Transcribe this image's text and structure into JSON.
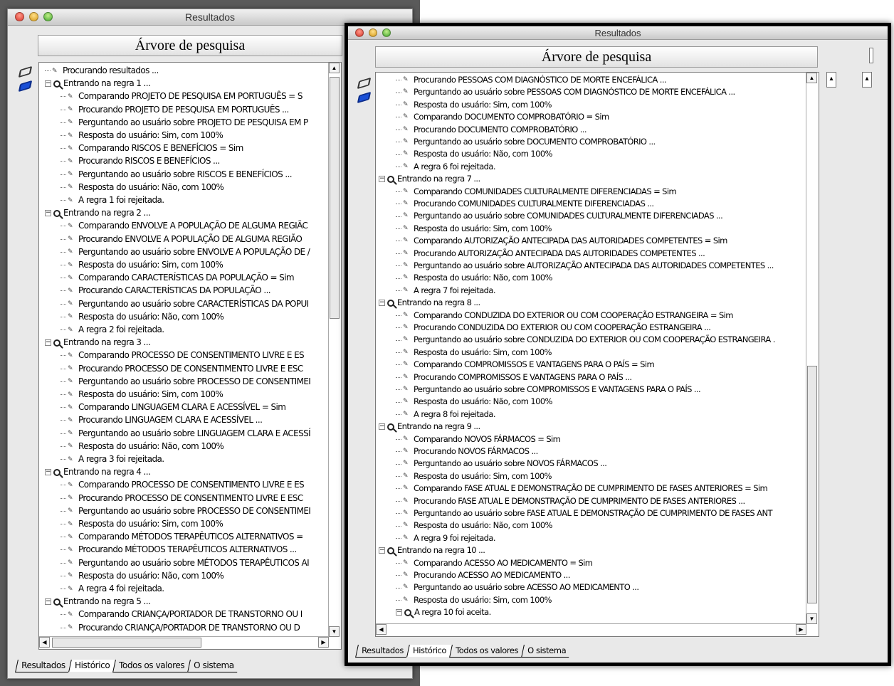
{
  "back_window": {
    "title": "Resultados",
    "header": "Árvore de pesquisa",
    "tabs": [
      "Resultados",
      "Histórico",
      "Todos os valores",
      "O sistema"
    ],
    "active_tab": 1,
    "tree": [
      {
        "level": 0,
        "type": "leaf",
        "text": "Procurando resultados ..."
      },
      {
        "level": 0,
        "type": "rule",
        "text": "Entrando na regra 1 ..."
      },
      {
        "level": 1,
        "type": "leaf",
        "text": "Comparando PROJETO DE PESQUISA EM PORTUGUÊS = S"
      },
      {
        "level": 1,
        "type": "leaf",
        "text": "Procurando PROJETO DE PESQUISA EM PORTUGUÊS ..."
      },
      {
        "level": 1,
        "type": "leaf",
        "text": "Perguntando ao usuário sobre PROJETO DE PESQUISA EM P"
      },
      {
        "level": 1,
        "type": "leaf",
        "text": "Resposta do usuário: Sim, com 100%"
      },
      {
        "level": 1,
        "type": "leaf",
        "text": "Comparando RISCOS E BENEFÍCIOS = Sim"
      },
      {
        "level": 1,
        "type": "leaf",
        "text": "Procurando RISCOS E BENEFÍCIOS ..."
      },
      {
        "level": 1,
        "type": "leaf",
        "text": "Perguntando ao usuário sobre RISCOS E BENEFÍCIOS ..."
      },
      {
        "level": 1,
        "type": "leaf",
        "text": "Resposta do usuário: Não, com 100%"
      },
      {
        "level": 1,
        "type": "leaf",
        "text": "A regra 1 foi rejeitada."
      },
      {
        "level": 0,
        "type": "rule",
        "text": "Entrando na regra 2 ..."
      },
      {
        "level": 1,
        "type": "leaf",
        "text": "Comparando ENVOLVE A POPULAÇÃO DE ALGUMA REGIÃC"
      },
      {
        "level": 1,
        "type": "leaf",
        "text": "Procurando ENVOLVE A POPULAÇÃO DE ALGUMA REGIÃO"
      },
      {
        "level": 1,
        "type": "leaf",
        "text": "Perguntando ao usuário sobre ENVOLVE A POPULAÇÃO DE /"
      },
      {
        "level": 1,
        "type": "leaf",
        "text": "Resposta do usuário: Sim, com 100%"
      },
      {
        "level": 1,
        "type": "leaf",
        "text": "Comparando CARACTERÍSTICAS DA POPULAÇÃO = Sim"
      },
      {
        "level": 1,
        "type": "leaf",
        "text": "Procurando CARACTERÍSTICAS DA POPULAÇÃO ..."
      },
      {
        "level": 1,
        "type": "leaf",
        "text": "Perguntando ao usuário sobre CARACTERÍSTICAS DA POPUI"
      },
      {
        "level": 1,
        "type": "leaf",
        "text": "Resposta do usuário: Não, com 100%"
      },
      {
        "level": 1,
        "type": "leaf",
        "text": "A regra 2 foi rejeitada."
      },
      {
        "level": 0,
        "type": "rule",
        "text": "Entrando na regra 3 ..."
      },
      {
        "level": 1,
        "type": "leaf",
        "text": "Comparando PROCESSO DE CONSENTIMENTO LIVRE E ES"
      },
      {
        "level": 1,
        "type": "leaf",
        "text": "Procurando PROCESSO DE CONSENTIMENTO LIVRE E ESC"
      },
      {
        "level": 1,
        "type": "leaf",
        "text": "Perguntando ao usuário sobre PROCESSO DE CONSENTIMEI"
      },
      {
        "level": 1,
        "type": "leaf",
        "text": "Resposta do usuário: Sim, com 100%"
      },
      {
        "level": 1,
        "type": "leaf",
        "text": "Comparando LINGUAGEM CLARA E ACESSÍVEL = Sim"
      },
      {
        "level": 1,
        "type": "leaf",
        "text": "Procurando LINGUAGEM CLARA E ACESSÍVEL ..."
      },
      {
        "level": 1,
        "type": "leaf",
        "text": "Perguntando ao usuário sobre LINGUAGEM CLARA E ACESSÍ"
      },
      {
        "level": 1,
        "type": "leaf",
        "text": "Resposta do usuário: Não, com 100%"
      },
      {
        "level": 1,
        "type": "leaf",
        "text": "A regra 3 foi rejeitada."
      },
      {
        "level": 0,
        "type": "rule",
        "text": "Entrando na regra 4 ..."
      },
      {
        "level": 1,
        "type": "leaf",
        "text": "Comparando PROCESSO DE CONSENTIMENTO LIVRE E ES"
      },
      {
        "level": 1,
        "type": "leaf",
        "text": "Procurando PROCESSO DE CONSENTIMENTO LIVRE E ESC"
      },
      {
        "level": 1,
        "type": "leaf",
        "text": "Perguntando ao usuário sobre PROCESSO DE CONSENTIMEI"
      },
      {
        "level": 1,
        "type": "leaf",
        "text": "Resposta do usuário: Sim, com 100%"
      },
      {
        "level": 1,
        "type": "leaf",
        "text": "Comparando MÉTODOS TERAPÊUTICOS ALTERNATIVOS ="
      },
      {
        "level": 1,
        "type": "leaf",
        "text": "Procurando MÉTODOS TERAPÊUTICOS ALTERNATIVOS ..."
      },
      {
        "level": 1,
        "type": "leaf",
        "text": "Perguntando ao usuário sobre MÉTODOS TERAPÊUTICOS AI"
      },
      {
        "level": 1,
        "type": "leaf",
        "text": "Resposta do usuário: Não, com 100%"
      },
      {
        "level": 1,
        "type": "leaf",
        "text": "A regra 4 foi rejeitada."
      },
      {
        "level": 0,
        "type": "rule",
        "text": "Entrando na regra 5 ..."
      },
      {
        "level": 1,
        "type": "leaf",
        "text": "Comparando CRIANÇA/PORTADOR DE TRANSTORNO OU I"
      },
      {
        "level": 1,
        "type": "leaf",
        "text": "Procurando CRIANÇA/PORTADOR DE TRANSTORNO OU D"
      }
    ]
  },
  "front_window": {
    "title": "Resultados",
    "header": "Árvore de pesquisa",
    "tabs": [
      "Resultados",
      "Histórico",
      "Todos os valores",
      "O sistema"
    ],
    "active_tab": 1,
    "tree": [
      {
        "level": 1,
        "type": "leaf",
        "text": "Procurando PESSOAS COM DIAGNÓSTICO DE MORTE ENCEFÁLICA ..."
      },
      {
        "level": 1,
        "type": "leaf",
        "text": "Perguntando ao usuário sobre PESSOAS COM DIAGNÓSTICO DE MORTE ENCEFÁLICA ..."
      },
      {
        "level": 1,
        "type": "leaf",
        "text": "Resposta do usuário: Sim, com 100%"
      },
      {
        "level": 1,
        "type": "leaf",
        "text": "Comparando DOCUMENTO COMPROBATÓRIO = Sim"
      },
      {
        "level": 1,
        "type": "leaf",
        "text": "Procurando DOCUMENTO COMPROBATÓRIO ..."
      },
      {
        "level": 1,
        "type": "leaf",
        "text": "Perguntando ao usuário sobre DOCUMENTO COMPROBATÓRIO ..."
      },
      {
        "level": 1,
        "type": "leaf",
        "text": "Resposta do usuário: Não, com 100%"
      },
      {
        "level": 1,
        "type": "leaf",
        "text": "A regra 6 foi rejeitada."
      },
      {
        "level": 0,
        "type": "rule",
        "text": "Entrando na regra 7 ..."
      },
      {
        "level": 1,
        "type": "leaf",
        "text": "Comparando COMUNIDADES CULTURALMENTE DIFERENCIADAS = Sim"
      },
      {
        "level": 1,
        "type": "leaf",
        "text": "Procurando COMUNIDADES CULTURALMENTE DIFERENCIADAS ..."
      },
      {
        "level": 1,
        "type": "leaf",
        "text": "Perguntando ao usuário sobre COMUNIDADES CULTURALMENTE DIFERENCIADAS ..."
      },
      {
        "level": 1,
        "type": "leaf",
        "text": "Resposta do usuário: Sim, com 100%"
      },
      {
        "level": 1,
        "type": "leaf",
        "text": "Comparando AUTORIZAÇÃO ANTECIPADA DAS AUTORIDADES COMPETENTES = Sim"
      },
      {
        "level": 1,
        "type": "leaf",
        "text": "Procurando AUTORIZAÇÃO ANTECIPADA DAS AUTORIDADES COMPETENTES ..."
      },
      {
        "level": 1,
        "type": "leaf",
        "text": "Perguntando ao usuário sobre AUTORIZAÇÃO ANTECIPADA DAS AUTORIDADES COMPETENTES ..."
      },
      {
        "level": 1,
        "type": "leaf",
        "text": "Resposta do usuário: Não, com 100%"
      },
      {
        "level": 1,
        "type": "leaf",
        "text": "A regra 7 foi rejeitada."
      },
      {
        "level": 0,
        "type": "rule",
        "text": "Entrando na regra 8 ..."
      },
      {
        "level": 1,
        "type": "leaf",
        "text": "Comparando CONDUZIDA DO EXTERIOR OU COM COOPERAÇÃO ESTRANGEIRA = Sim"
      },
      {
        "level": 1,
        "type": "leaf",
        "text": "Procurando CONDUZIDA DO EXTERIOR OU COM COOPERAÇÃO ESTRANGEIRA ..."
      },
      {
        "level": 1,
        "type": "leaf",
        "text": "Perguntando ao usuário sobre CONDUZIDA DO EXTERIOR OU COM COOPERAÇÃO ESTRANGEIRA ."
      },
      {
        "level": 1,
        "type": "leaf",
        "text": "Resposta do usuário: Sim, com 100%"
      },
      {
        "level": 1,
        "type": "leaf",
        "text": "Comparando COMPROMISSOS E VANTAGENS PARA O PAÍS = Sim"
      },
      {
        "level": 1,
        "type": "leaf",
        "text": "Procurando COMPROMISSOS E VANTAGENS PARA O PAÍS ..."
      },
      {
        "level": 1,
        "type": "leaf",
        "text": "Perguntando ao usuário sobre COMPROMISSOS E VANTAGENS PARA O PAÍS ..."
      },
      {
        "level": 1,
        "type": "leaf",
        "text": "Resposta do usuário: Não, com 100%"
      },
      {
        "level": 1,
        "type": "leaf",
        "text": "A regra 8 foi rejeitada."
      },
      {
        "level": 0,
        "type": "rule",
        "text": "Entrando na regra 9 ..."
      },
      {
        "level": 1,
        "type": "leaf",
        "text": "Comparando NOVOS FÁRMACOS = Sim"
      },
      {
        "level": 1,
        "type": "leaf",
        "text": "Procurando NOVOS FÁRMACOS ..."
      },
      {
        "level": 1,
        "type": "leaf",
        "text": "Perguntando ao usuário sobre NOVOS FÁRMACOS ..."
      },
      {
        "level": 1,
        "type": "leaf",
        "text": "Resposta do usuário: Sim, com 100%"
      },
      {
        "level": 1,
        "type": "leaf",
        "text": "Comparando FASE ATUAL E DEMONSTRAÇÃO DE CUMPRIMENTO DE FASES ANTERIORES = Sim"
      },
      {
        "level": 1,
        "type": "leaf",
        "text": "Procurando FASE ATUAL E DEMONSTRAÇÃO DE CUMPRIMENTO DE FASES ANTERIORES ..."
      },
      {
        "level": 1,
        "type": "leaf",
        "text": "Perguntando ao usuário sobre FASE ATUAL E DEMONSTRAÇÃO DE CUMPRIMENTO DE FASES ANT"
      },
      {
        "level": 1,
        "type": "leaf",
        "text": "Resposta do usuário: Não, com 100%"
      },
      {
        "level": 1,
        "type": "leaf",
        "text": "A regra 9 foi rejeitada."
      },
      {
        "level": 0,
        "type": "rule",
        "text": "Entrando na regra 10 ..."
      },
      {
        "level": 1,
        "type": "leaf",
        "text": "Comparando ACESSO AO MEDICAMENTO = Sim"
      },
      {
        "level": 1,
        "type": "leaf",
        "text": "Procurando ACESSO AO MEDICAMENTO ..."
      },
      {
        "level": 1,
        "type": "leaf",
        "text": "Perguntando ao usuário sobre ACESSO AO MEDICAMENTO ..."
      },
      {
        "level": 1,
        "type": "leaf",
        "text": "Resposta do usuário: Sim, com 100%"
      },
      {
        "level": 1,
        "type": "rule",
        "text": "A regra 10 foi aceita."
      }
    ]
  }
}
